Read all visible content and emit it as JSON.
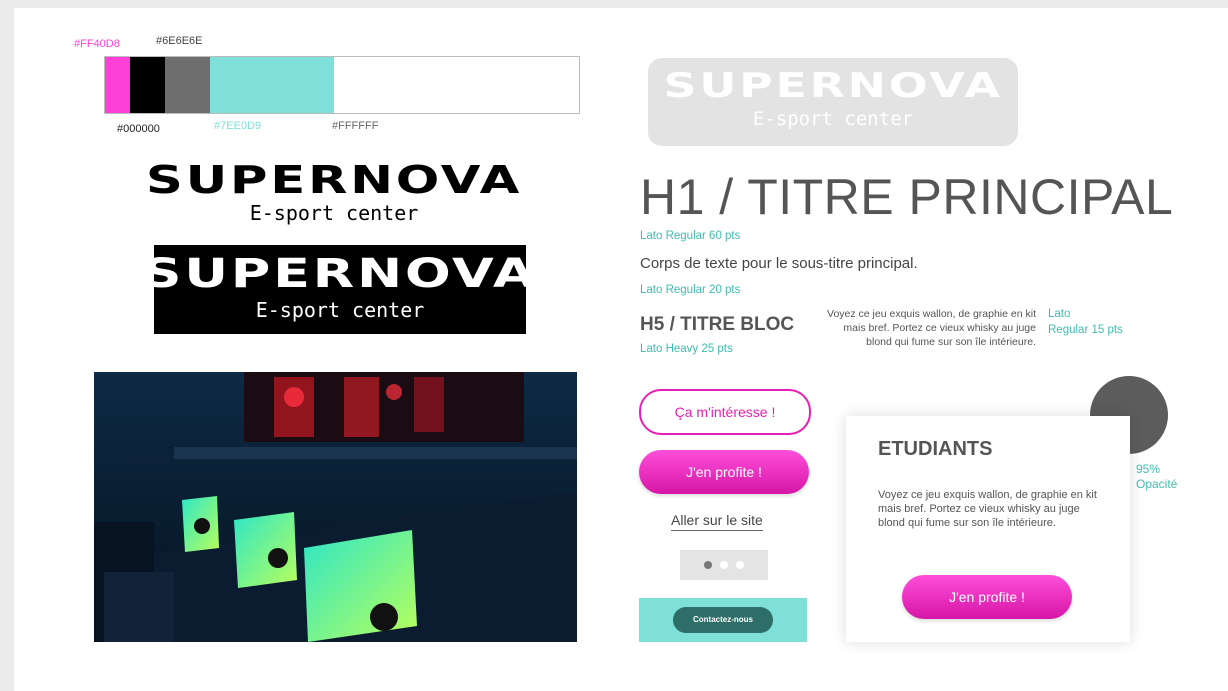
{
  "palette": {
    "labels": {
      "pink": "#FF40D8",
      "gray": "#6E6E6E",
      "black": "#000000",
      "teal": "#7EE0D9",
      "white": "#FFFFFF"
    },
    "colors": [
      "#FF40D8",
      "#000000",
      "#6E6E6E",
      "#7EE0D9",
      "#FFFFFF"
    ]
  },
  "logo": {
    "name": "SUPERNOVA",
    "tagline": "E-sport center"
  },
  "typography": {
    "h1": "H1 / TITRE PRINCIPAL",
    "h1_spec": "Lato Regular 60 pts",
    "body": "Corps de texte pour le sous-titre principal.",
    "body_spec": "Lato Regular 20 pts",
    "h5": "H5 / TITRE BLOC",
    "h5_spec": "Lato Heavy 25 pts",
    "paragraph": "Voyez ce jeu exquis wallon, de graphie en kit mais bref. Portez ce vieux whisky au juge blond qui fume sur son île intérieure.",
    "paragraph_spec_1": "Lato",
    "paragraph_spec_2": "Regular 15 pts"
  },
  "buttons": {
    "outline": "Ça m'intéresse !",
    "filled": "J'en profite !",
    "link": "Aller sur le site",
    "contact": "Contactez-nous"
  },
  "carousel": {
    "count": 3,
    "active": 0
  },
  "card": {
    "title": "ETUDIANTS",
    "text": "Voyez ce jeu exquis wallon, de graphie en kit mais bref. Portez ce vieux whisky au juge blond qui fume sur son île intérieure.",
    "button": "J'en profite !"
  },
  "opacity": {
    "value": "95%",
    "label": "Opacité"
  }
}
